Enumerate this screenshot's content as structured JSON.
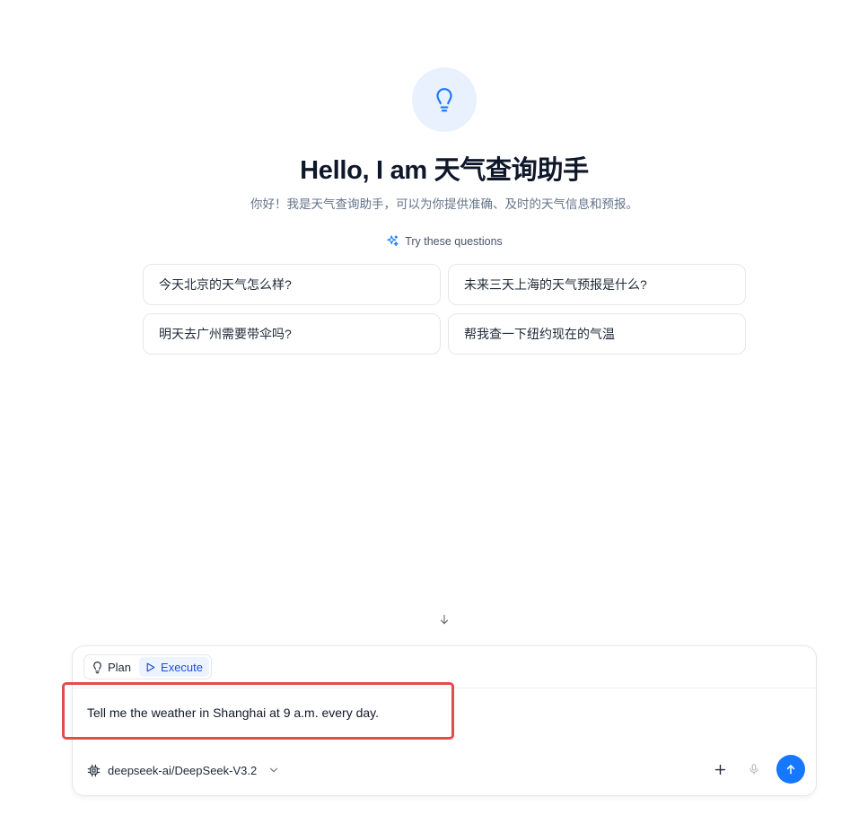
{
  "welcome": {
    "title": "Hello, I am 天气查询助手",
    "subtitle": "你好！我是天气查询助手，可以为你提供准确、及时的天气信息和预报。",
    "try_label": "Try these questions"
  },
  "suggestions": [
    "今天北京的天气怎么样?",
    "未来三天上海的天气预报是什么?",
    "明天去广州需要带伞吗?",
    "帮我查一下纽约现在的气温"
  ],
  "composer": {
    "modes": {
      "plan_label": "Plan",
      "execute_label": "Execute",
      "active": "Execute"
    },
    "input_value": "Tell me the weather in Shanghai at 9 a.m. every day.",
    "model_name": "deepseek-ai/DeepSeek-V3.2"
  },
  "colors": {
    "accent": "#1677ff",
    "highlight": "#e24c4c",
    "hero_bg": "#e8f1fd"
  },
  "icons": {
    "hero": "lightbulb-icon",
    "try": "sparkles-icon",
    "scroll": "arrow-down-icon",
    "plan": "lightbulb-icon",
    "execute": "play-icon",
    "model": "cpu-chip-icon",
    "model_dropdown": "chevron-down-icon",
    "add": "plus-icon",
    "voice": "microphone-icon",
    "send": "arrow-up-icon"
  }
}
